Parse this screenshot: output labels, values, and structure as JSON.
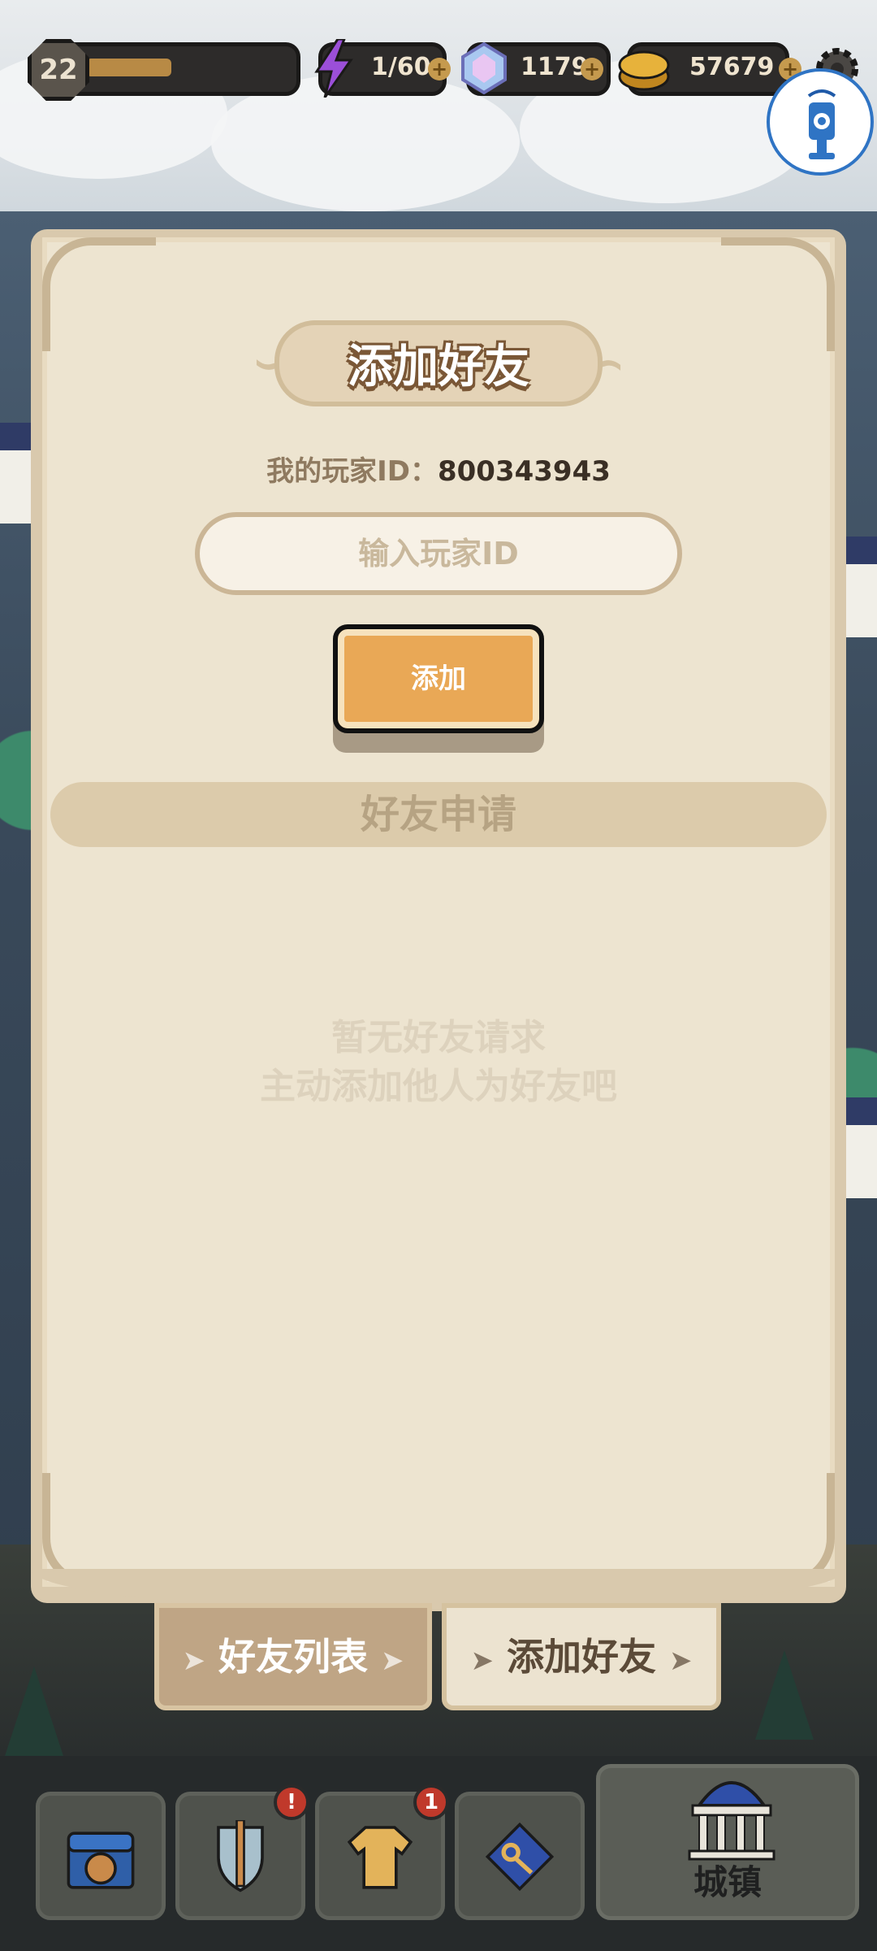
{
  "hud": {
    "level": "22",
    "xp_fraction": 0.42,
    "energy": "1/60",
    "gems": "1179",
    "coins": "57679",
    "plus_symbol": "+"
  },
  "dialog": {
    "title": "添加好友",
    "player_id_label": "我的玩家ID：",
    "player_id_value": "800343943",
    "input_placeholder": "输入玩家ID",
    "add_button": "添加",
    "section_title": "好友申请",
    "empty_line1": "暂无好友请求",
    "empty_line2": "主动添加他人为好友吧"
  },
  "tabs": [
    {
      "label": "好友列表",
      "active": false
    },
    {
      "label": "添加好友",
      "active": true
    }
  ],
  "bottom_nav": {
    "items": [
      {
        "icon": "treasure-chest-icon",
        "badge": ""
      },
      {
        "icon": "sword-shield-icon",
        "badge": "!"
      },
      {
        "icon": "armor-icon",
        "badge": "1"
      },
      {
        "icon": "key-map-icon",
        "badge": ""
      }
    ],
    "town_label": "城镇"
  },
  "colors": {
    "panel": "#ede4d0",
    "accent_orange": "#e9a856",
    "badge_red": "#c0392b"
  }
}
